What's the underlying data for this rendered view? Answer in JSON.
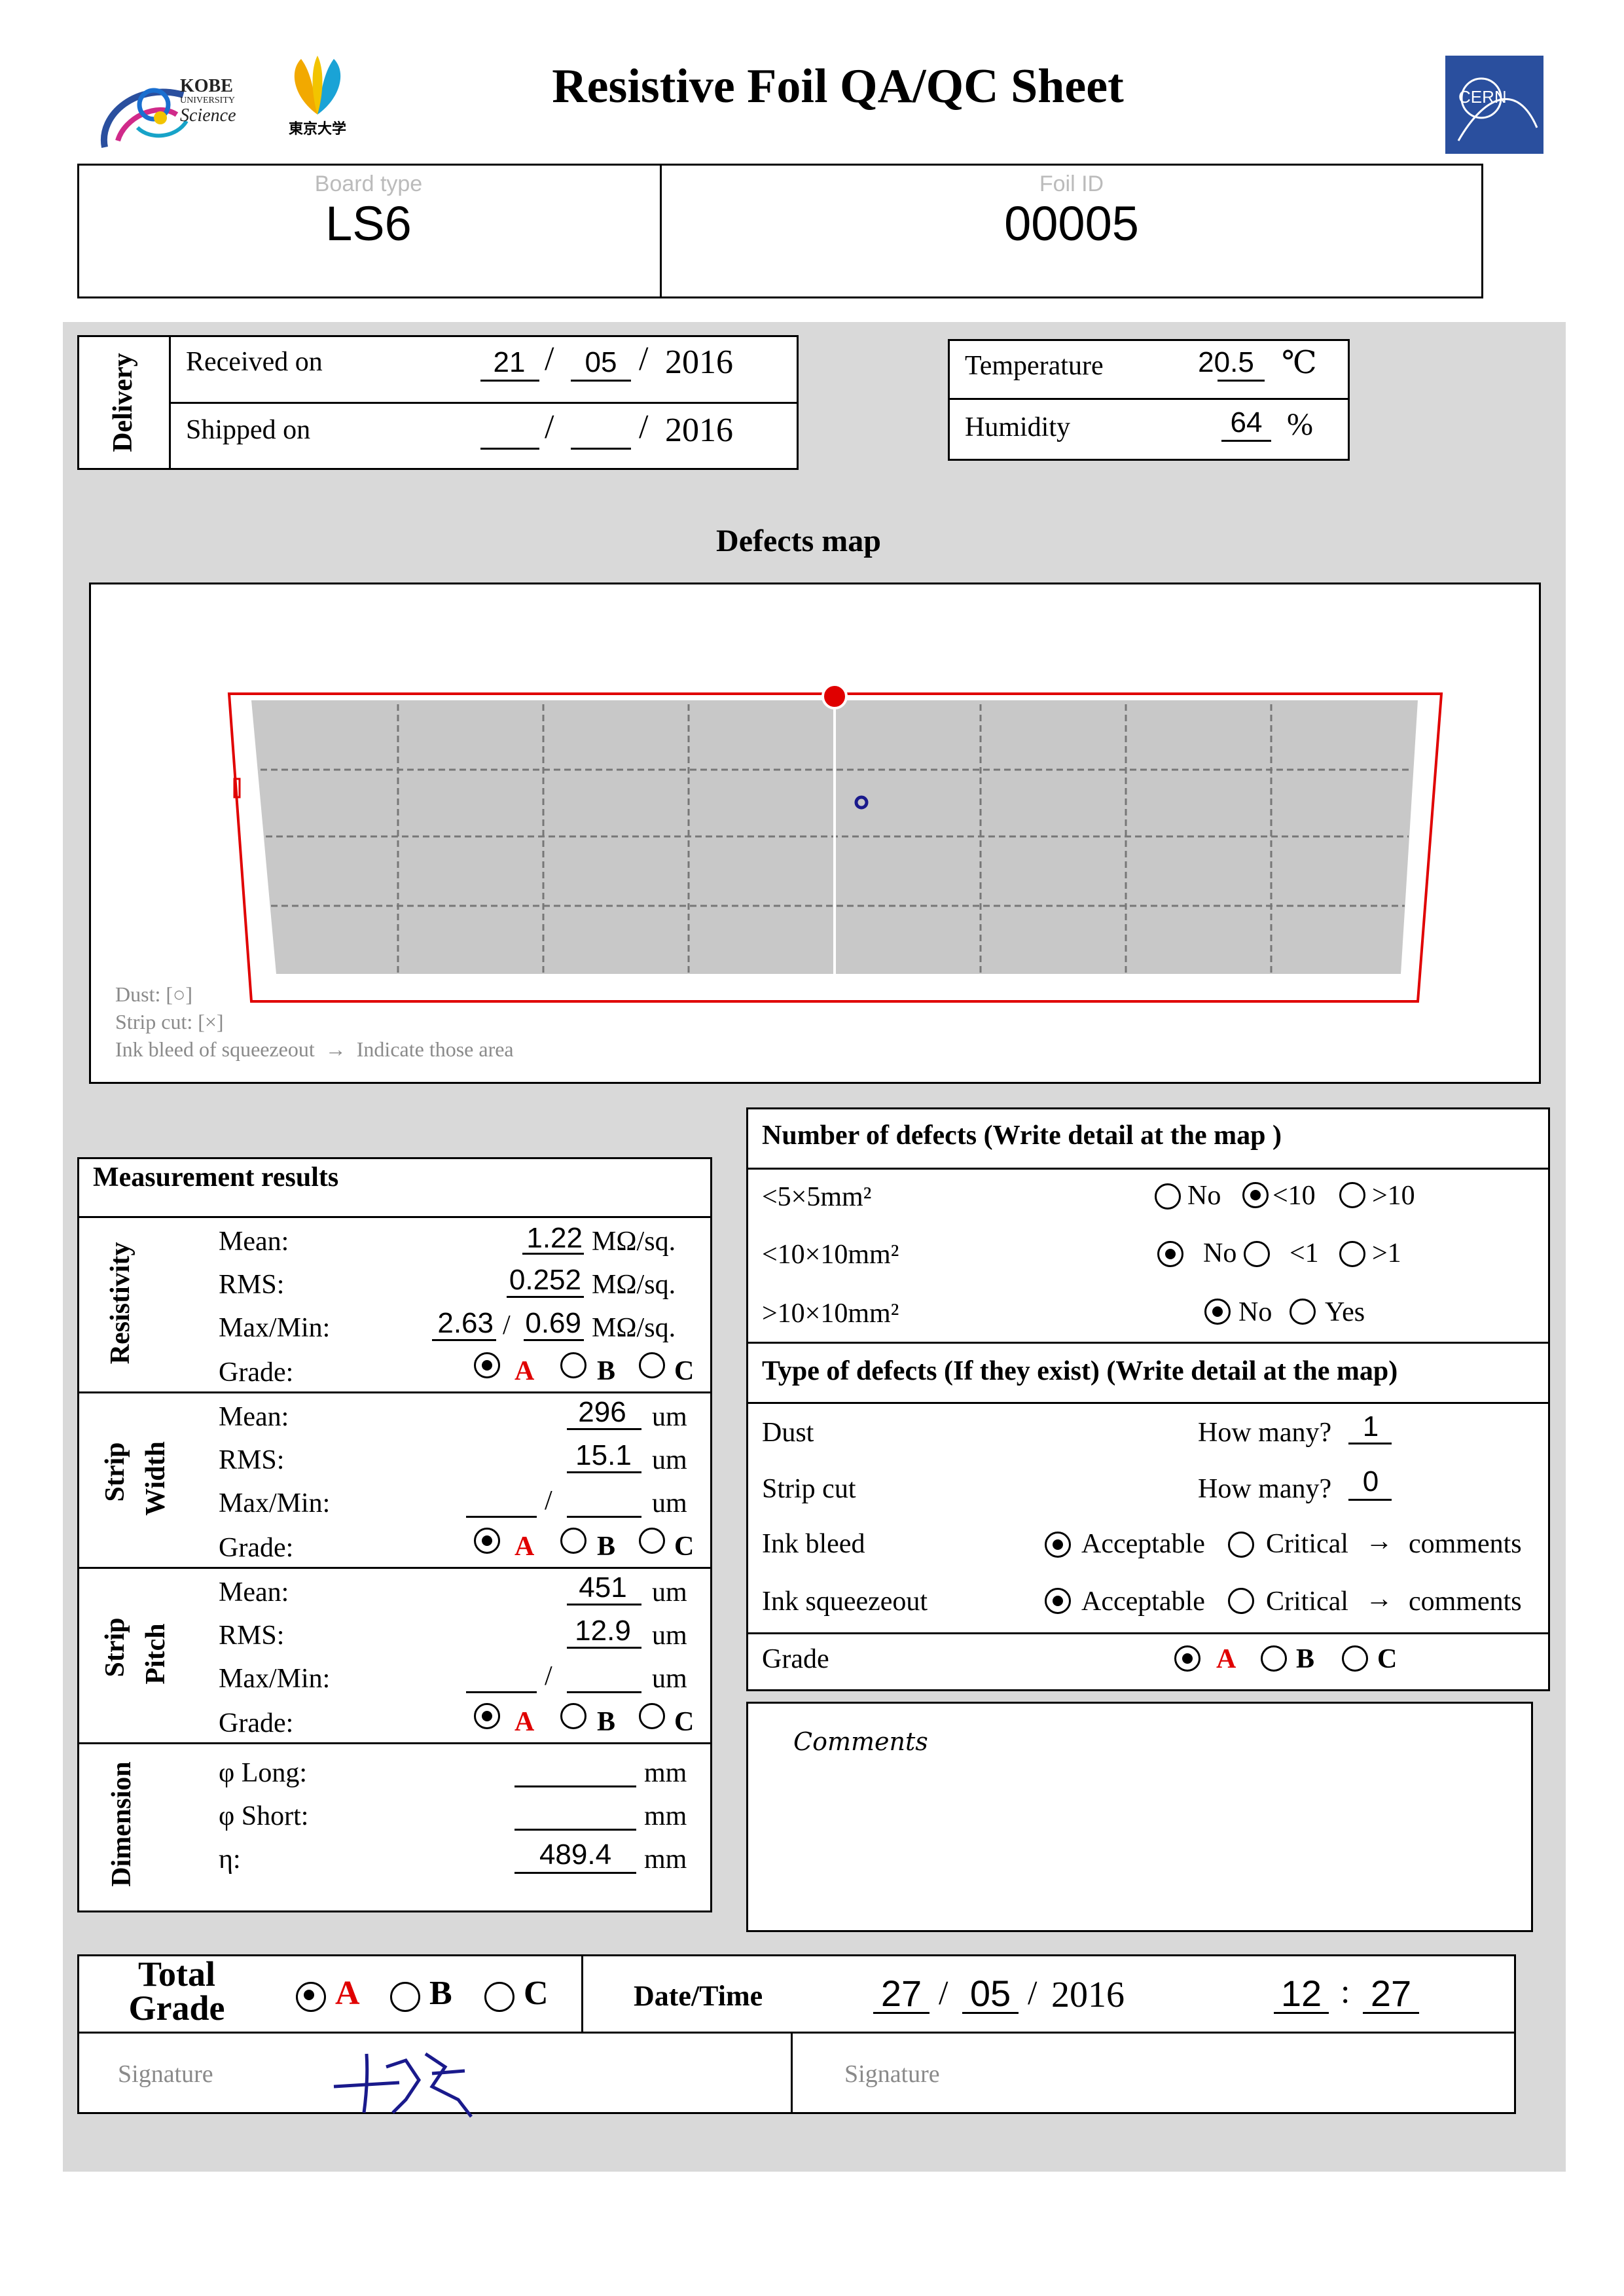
{
  "header": {
    "title": "Resistive Foil QA/QC Sheet",
    "kobe_logo": {
      "line1": "KOBE",
      "line2": "UNIVERSITY",
      "line3": "Science"
    },
    "tokyo_logo": {
      "label": "東京大学"
    },
    "cern_logo": {
      "label": "CERN"
    }
  },
  "board": {
    "type_label": "Board type",
    "type_value": "LS6",
    "id_label": "Foil ID",
    "id_value": "00005"
  },
  "delivery": {
    "section_label": "Delivery",
    "received_label": "Received on",
    "received_day": "21",
    "received_month": "05",
    "received_year": "2016",
    "shipped_label": "Shipped on",
    "shipped_day": "",
    "shipped_month": "",
    "shipped_year": "2016",
    "slash": "/"
  },
  "environment": {
    "temperature_label": "Temperature",
    "temperature_value": "20.5",
    "temperature_unit": "℃",
    "humidity_label": "Humidity",
    "humidity_value": "64",
    "humidity_unit": "%"
  },
  "defects_map": {
    "title": "Defects map",
    "legend_dust": "Dust: [○]",
    "legend_strip_cut": "Strip cut: [×]",
    "legend_ink": "Ink bleed of squeezeout  →  Indicate those area",
    "dust_mark": "o"
  },
  "measurement": {
    "title": "Measurement results",
    "resistivity": {
      "section_label": "Resistivity",
      "mean_label": "Mean:",
      "mean_value": "1.22",
      "unit": "MΩ/sq.",
      "rms_label": "RMS:",
      "rms_value": "0.252",
      "maxmin_label": "Max/Min:",
      "max_value": "2.63",
      "min_value": "0.69",
      "grade_label": "Grade:",
      "grade_selected": "A"
    },
    "strip_width": {
      "section_label_1": "Strip",
      "section_label_2": "Width",
      "mean_label": "Mean:",
      "mean_value": "296",
      "unit": "um",
      "rms_label": "RMS:",
      "rms_value": "15.1",
      "maxmin_label": "Max/Min:",
      "max_value": "",
      "min_value": "",
      "grade_label": "Grade:",
      "grade_selected": "A"
    },
    "strip_pitch": {
      "section_label_1": "Strip",
      "section_label_2": "Pitch",
      "mean_label": "Mean:",
      "mean_value": "451",
      "unit": "um",
      "rms_label": "RMS:",
      "rms_value": "12.9",
      "maxmin_label": "Max/Min:",
      "max_value": "",
      "min_value": "",
      "grade_label": "Grade:",
      "grade_selected": "A"
    },
    "dimension": {
      "section_label": "Dimension",
      "long_label": "φ Long:",
      "long_value": "",
      "short_label": "φ Short:",
      "short_value": "",
      "eta_label": "η:",
      "eta_value": "489.4",
      "unit": "mm"
    },
    "grade_options": [
      "A",
      "B",
      "C"
    ]
  },
  "defects": {
    "number_title": "Number of defects (Write detail at the map )",
    "row1_label": "<5×5mm²",
    "row1_options": [
      "No",
      "<10",
      ">10"
    ],
    "row1_selected": "<10",
    "row2_label": "<10×10mm²",
    "row2_options": [
      "No",
      "<1",
      ">1"
    ],
    "row2_selected": "No",
    "row3_label": ">10×10mm²",
    "row3_options": [
      "No",
      "Yes"
    ],
    "row3_selected": "No",
    "type_title": "Type of defects (If they exist) (Write detail at the map)",
    "dust_label": "Dust",
    "dust_how_many": "How many?",
    "dust_value": "1",
    "strip_cut_label": "Strip cut",
    "strip_cut_how_many": "How many?",
    "strip_cut_value": "0",
    "ink_bleed_label": "Ink bleed",
    "ink_squeeze_label": "Ink squeezeout",
    "acceptable": "Acceptable",
    "critical": "Critical",
    "arrow": "→",
    "comments": "comments",
    "ink_bleed_selected": "Acceptable",
    "ink_squeeze_selected": "Acceptable",
    "grade_label": "Grade",
    "grade_selected": "A"
  },
  "comments": {
    "title": "Comments",
    "text": ""
  },
  "total": {
    "label_1": "Total",
    "label_2": "Grade",
    "selected": "A",
    "date_label": "Date/Time",
    "day": "27",
    "month": "05",
    "year": "2016",
    "hour": "12",
    "minute": "27",
    "colon": ":",
    "signature_label_1": "Signature",
    "signature_label_2": "Signature"
  },
  "colors": {
    "panel_bg": "#d9d9d9",
    "accent_red": "#e00000",
    "foil_gray": "#c8c8c8",
    "cern_blue": "#2a4f9e",
    "ink_blue": "#1a1a8c"
  }
}
